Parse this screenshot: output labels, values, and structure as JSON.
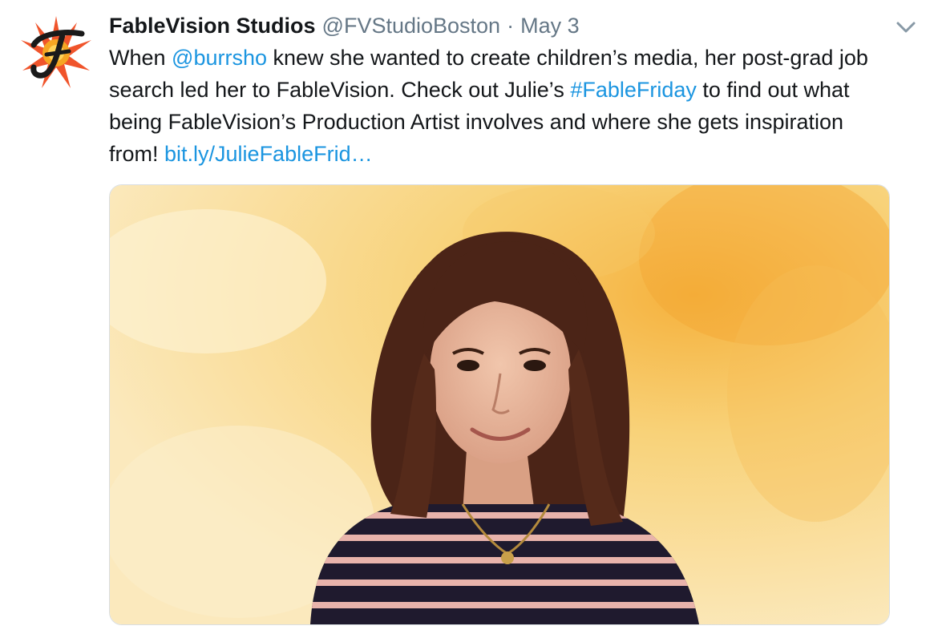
{
  "tweet": {
    "author_name": "FableVision Studios",
    "author_handle": "@FVStudioBoston",
    "separator": "·",
    "date": "May 3",
    "text_lines": [
      [
        {
          "t": "When ",
          "link": false
        },
        {
          "t": "@burrsho",
          "link": true
        },
        {
          "t": " knew she wanted to create children’s media, her post-grad job",
          "link": false
        }
      ],
      [
        {
          "t": "search led her to FableVision. Check out Julie’s ",
          "link": false
        },
        {
          "t": "#FableFriday",
          "link": true
        },
        {
          "t": " to find out what",
          "link": false
        }
      ],
      [
        {
          "t": "being FableVision’s Production Artist involves and where she gets inspiration",
          "link": false
        }
      ],
      [
        {
          "t": "from! ",
          "link": false
        },
        {
          "t": "bit.ly/JulieFableFrid…",
          "link": true
        }
      ]
    ],
    "avatar_icon": "fablevision-logo-icon",
    "menu_icon": "chevron-down-icon",
    "media_icon": "photo-woman-striped-shirt",
    "colors": {
      "link": "#1b95e0",
      "name": "#14171a",
      "muted": "#657786",
      "logo_star": "#f0542b",
      "logo_sun": "#f6a623"
    }
  }
}
